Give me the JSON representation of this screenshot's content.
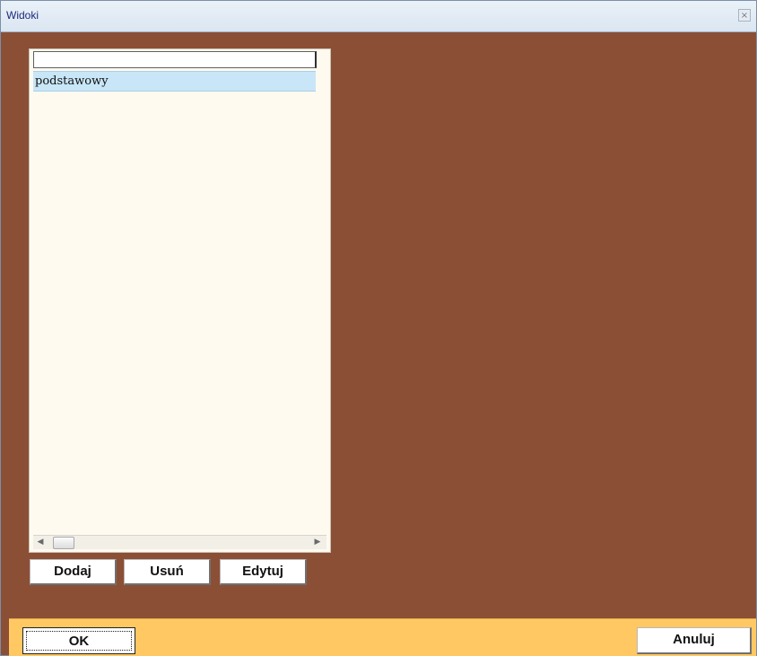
{
  "window": {
    "title": "Widoki",
    "close_icon": "close-icon"
  },
  "list": {
    "items": [
      "podstawowy"
    ],
    "selected_index": 0
  },
  "buttons": {
    "add": "Dodaj",
    "remove": "Usuń",
    "edit": "Edytuj",
    "ok": "OK",
    "cancel": "Anuluj"
  },
  "colors": {
    "background": "#8b4f36",
    "list_background": "#fffaf0",
    "selected_row": "#c8e6f7",
    "footer": "#ffc862"
  }
}
